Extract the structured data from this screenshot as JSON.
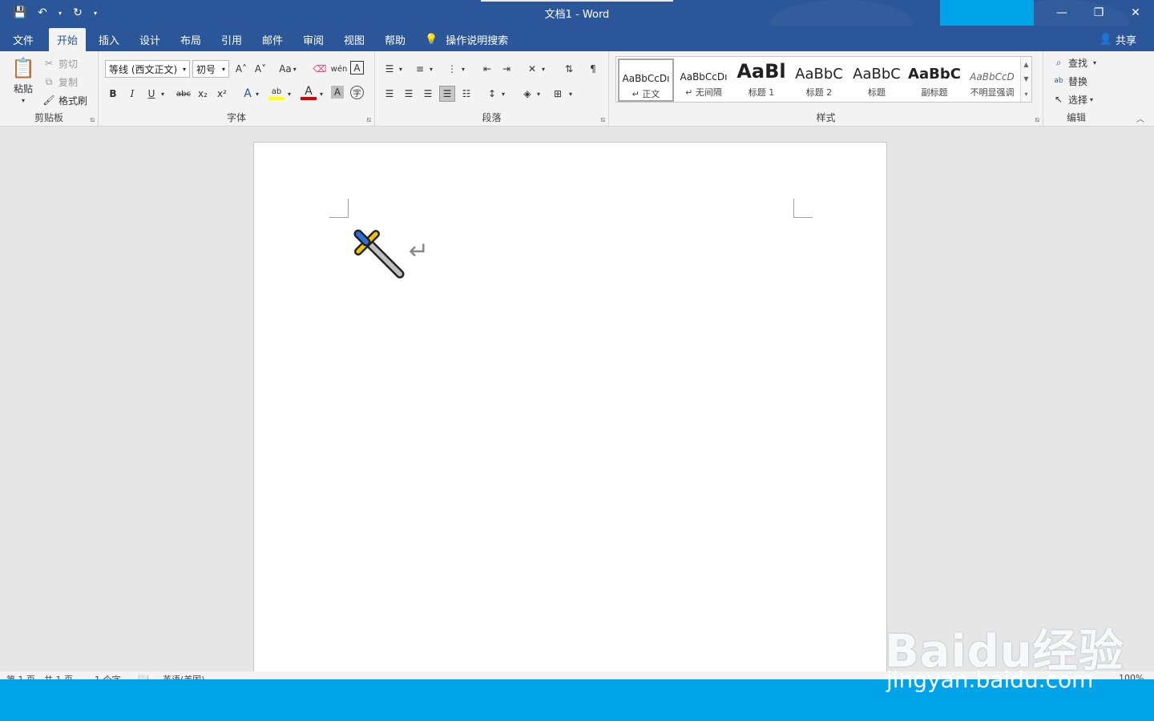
{
  "titlebar": {
    "title": "文档1  -  Word",
    "window_controls": {
      "minimize": "—",
      "restore": "❐",
      "close": "✕"
    },
    "qat": {
      "save": "💾",
      "undo": "↶",
      "redo": "↻",
      "more": "▾"
    }
  },
  "tabs": {
    "items": [
      "文件",
      "开始",
      "插入",
      "设计",
      "布局",
      "引用",
      "邮件",
      "审阅",
      "视图",
      "帮助"
    ],
    "active": "开始",
    "tellme": "操作说明搜索",
    "share": "共享"
  },
  "ribbon": {
    "clipboard": {
      "label": "剪贴板",
      "paste": "粘贴",
      "cut": "剪切",
      "copy": "复制",
      "format_painter": "格式刷"
    },
    "font": {
      "label": "字体",
      "font_name": "等线 (西文正文)",
      "font_size": "初号",
      "grow": "A˄",
      "shrink": "A˅",
      "change_case": "Aa",
      "bold": "B",
      "italic": "I",
      "underline": "U",
      "strike": "abc",
      "subscript": "x₂",
      "superscript": "x²"
    },
    "paragraph": {
      "label": "段落"
    },
    "styles": {
      "label": "样式",
      "items": [
        {
          "preview": "AaBbCcDı",
          "name": "↵ 正文"
        },
        {
          "preview": "AaBbCcDı",
          "name": "↵ 无间隔"
        },
        {
          "preview": "AaBl",
          "name": "标题 1"
        },
        {
          "preview": "AaBbC",
          "name": "标题 2"
        },
        {
          "preview": "AaBbC",
          "name": "标题"
        },
        {
          "preview": "AaBbC",
          "name": "副标题"
        },
        {
          "preview": "AaBbCcD",
          "name": "不明显强调"
        }
      ]
    },
    "editing": {
      "label": "编辑",
      "find": "查找",
      "replace": "替换",
      "select": "选择"
    }
  },
  "document": {
    "pilcrow": "↵"
  },
  "statusbar": {
    "page": "第 1 页，共 1 页",
    "words": "1 个字",
    "language": "英语(美国)",
    "zoom": "100%"
  },
  "watermark": {
    "main": "Baidu经验",
    "sub": "jingyan.baidu.com"
  },
  "colors": {
    "title_bar": "#2b579a",
    "ribbon_bg": "#f3f3f3",
    "accent_cyan": "#00a2e8",
    "highlight_yellow": "#ffff00",
    "font_red": "#e00000"
  }
}
